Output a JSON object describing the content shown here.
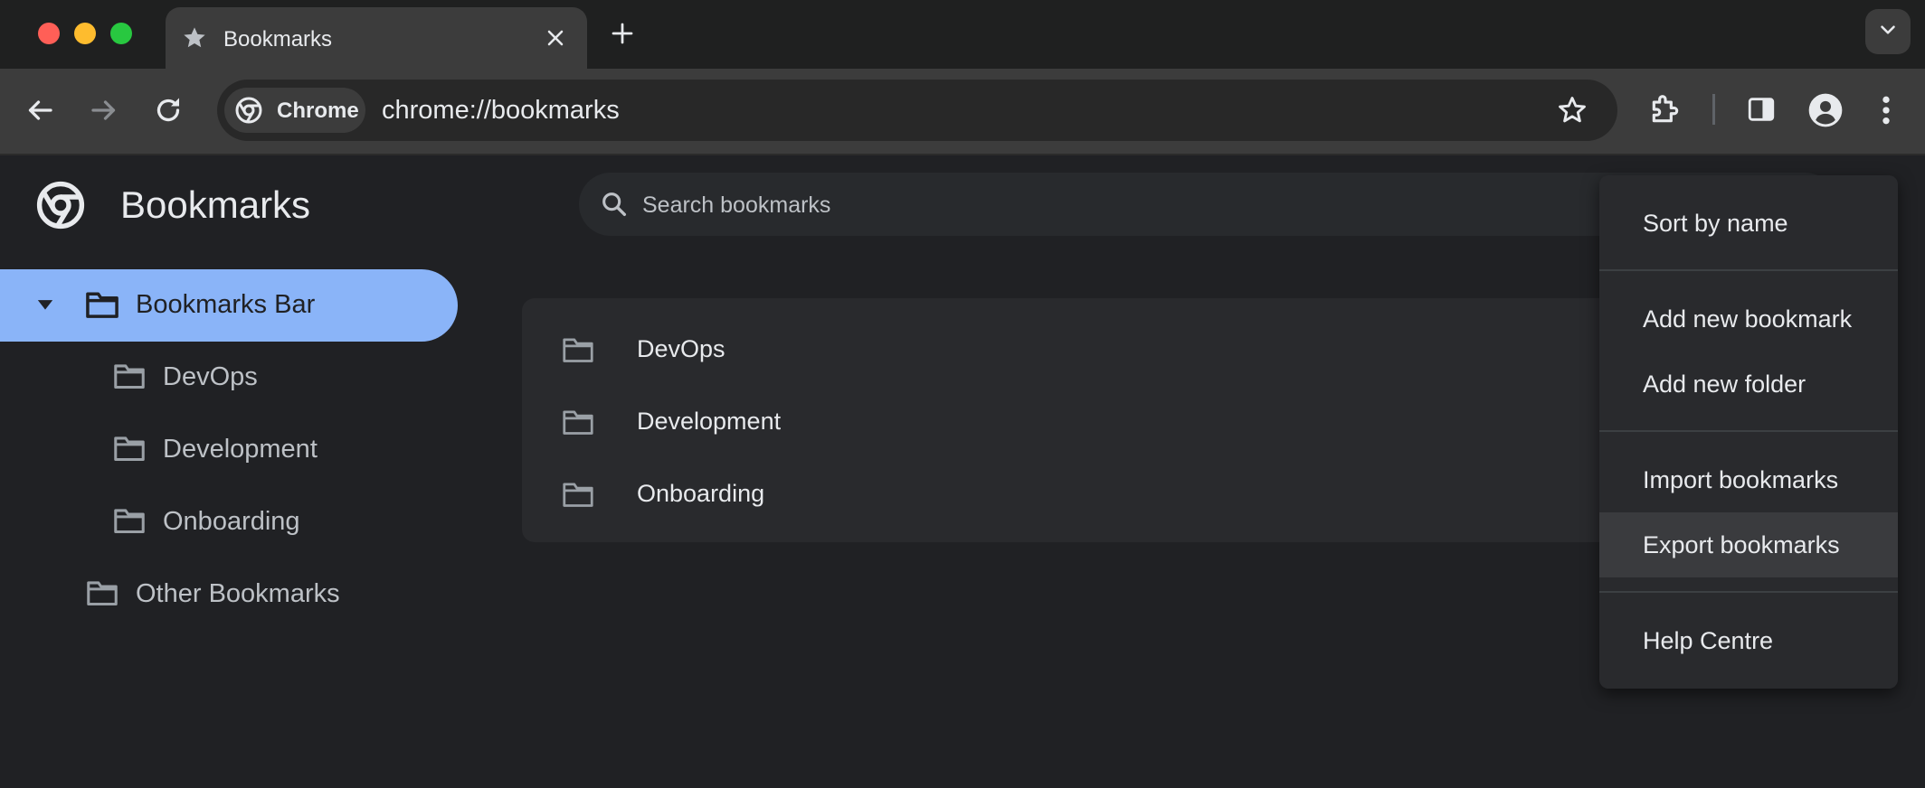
{
  "colors": {
    "accent": "#8ab4f8",
    "close": "#ff5f57",
    "minimize": "#febc2e",
    "maximize": "#28c840"
  },
  "tab": {
    "title": "Bookmarks",
    "icon": "star-icon"
  },
  "omnibox": {
    "chip_label": "Chrome",
    "url": "chrome://bookmarks"
  },
  "page": {
    "title": "Bookmarks",
    "search_placeholder": "Search bookmarks"
  },
  "sidebar": {
    "items": [
      {
        "label": "Bookmarks Bar",
        "selected": true,
        "expanded": true
      },
      {
        "label": "DevOps"
      },
      {
        "label": "Development"
      },
      {
        "label": "Onboarding"
      },
      {
        "label": "Other Bookmarks"
      }
    ]
  },
  "list": {
    "items": [
      {
        "label": "DevOps"
      },
      {
        "label": "Development"
      },
      {
        "label": "Onboarding"
      }
    ]
  },
  "menu": {
    "sort": "Sort by name",
    "add_bookmark": "Add new bookmark",
    "add_folder": "Add new folder",
    "import": "Import bookmarks",
    "export": "Export bookmarks",
    "help": "Help Centre"
  }
}
